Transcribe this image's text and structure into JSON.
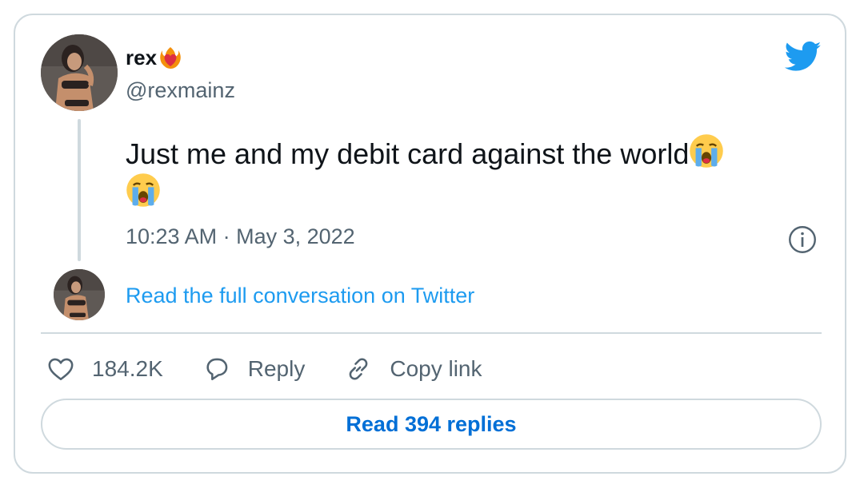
{
  "author": {
    "name": "rex",
    "name_emoji_icon": "heart-on-fire-icon",
    "handle": "@rexmainz",
    "avatar": "profile-photo"
  },
  "tweet": {
    "text": "Just me and my debit card against the world",
    "emojis": [
      "loudly-crying-face-icon",
      "loudly-crying-face-icon"
    ],
    "time": "10:23 AM",
    "separator": "·",
    "date": "May 3, 2022"
  },
  "conversation_link": "Read the full conversation on Twitter",
  "actions": {
    "likes": "184.2K",
    "reply_label": "Reply",
    "copy_link_label": "Copy link"
  },
  "read_replies_label": "Read 394 replies",
  "colors": {
    "brand_blue": "#1d9bf0",
    "link_blue": "#006fd6",
    "secondary_text": "#536471",
    "border": "#cfd9de"
  }
}
